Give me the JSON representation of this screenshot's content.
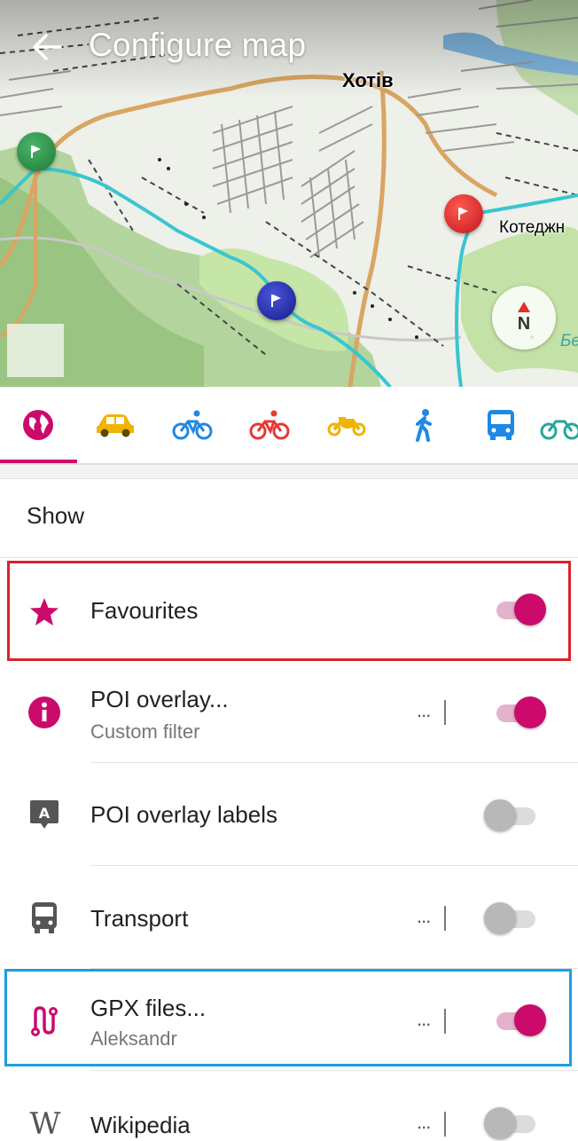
{
  "header": {
    "title": "Configure map",
    "back_icon": "arrow-left-icon"
  },
  "map": {
    "places": {
      "khotiv": "Хотів",
      "kotedzh": "Котеджн",
      "partial": "Бе"
    },
    "compass_label": "N"
  },
  "profiles": [
    {
      "name": "world-icon",
      "color": "#cb0a6c",
      "selected": true
    },
    {
      "name": "car-icon",
      "color": "#f0b400"
    },
    {
      "name": "bicycle-icon",
      "color": "#1e88e5"
    },
    {
      "name": "bicycle-icon",
      "color": "#e53935"
    },
    {
      "name": "motorcycle-icon",
      "color": "#f0b400"
    },
    {
      "name": "pedestrian-icon",
      "color": "#1e88e5"
    },
    {
      "name": "bus-icon",
      "color": "#1e88e5"
    },
    {
      "name": "bicycle-icon",
      "color": "#26a69a"
    }
  ],
  "section": {
    "title": "Show"
  },
  "items": [
    {
      "label": "Favourites",
      "icon": "star-icon",
      "enabled": true,
      "highlight": "#d9232b"
    },
    {
      "label": "POI overlay...",
      "sub": "Custom filter",
      "icon": "info-icon",
      "more": "...",
      "enabled": true
    },
    {
      "label": "POI overlay labels",
      "icon": "label-icon",
      "enabled": false
    },
    {
      "label": "Transport",
      "icon": "bus-icon",
      "more": "...",
      "enabled": false
    },
    {
      "label": "GPX files...",
      "sub": "Aleksandr",
      "icon": "route-icon",
      "more": "...",
      "enabled": true,
      "highlight": "#1d9ee0"
    },
    {
      "label": "Wikipedia",
      "icon": "wikipedia-icon",
      "more": "...",
      "enabled": false
    }
  ],
  "colors": {
    "accent": "#cb0a6c"
  }
}
